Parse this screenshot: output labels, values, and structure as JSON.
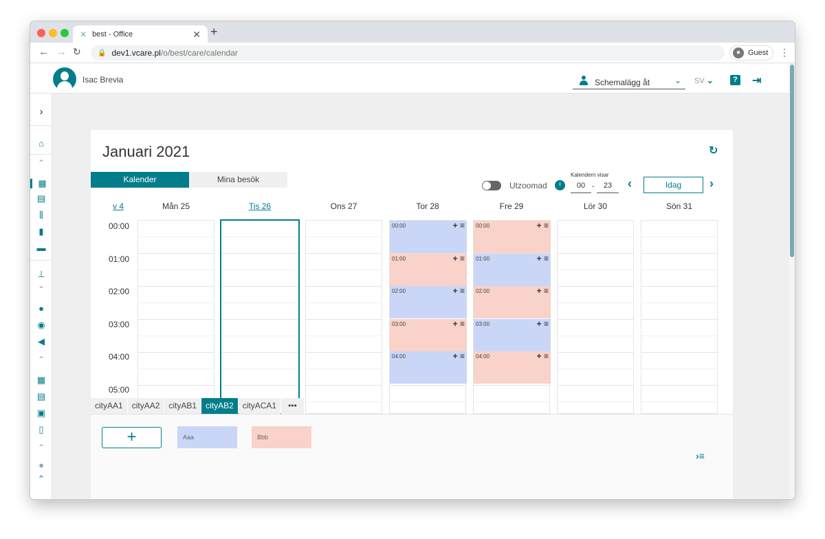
{
  "browser": {
    "tab_title": "best - Office",
    "tab_close": "✕",
    "new_tab": "+",
    "url_domain": "dev1.vcare.pl",
    "url_path": "/o/best/care/calendar",
    "profile_label": "Guest"
  },
  "header": {
    "user_name": "Isac Brevia",
    "schedule_label": "Schemalägg åt",
    "language": "SV",
    "help_label": "?"
  },
  "calendar": {
    "month_title": "Januari 2021",
    "view_tabs": [
      "Kalender",
      "Mina besök"
    ],
    "zoom_label": "Utzoomad",
    "hours_caption": "Kalendern visar",
    "hour_from": "00",
    "hour_to": "23",
    "hour_sep": "-",
    "today_button": "Idag",
    "week_label": "v 4",
    "days": [
      "Mån 25",
      "Tis 26",
      "Ons 27",
      "Tor 28",
      "Fre 29",
      "Lör 30",
      "Sön 31"
    ],
    "today_index": 1,
    "times": [
      "00:00",
      "01:00",
      "02:00",
      "03:00",
      "04:00",
      "05:00"
    ],
    "slots": {
      "thursday": [
        {
          "time": "00:00",
          "color": "#c9d6f7"
        },
        {
          "time": "01:00",
          "color": "#f9d2ca"
        },
        {
          "time": "02:00",
          "color": "#c9d6f7"
        },
        {
          "time": "03:00",
          "color": "#f9d2ca"
        },
        {
          "time": "04:00",
          "color": "#c9d6f7"
        }
      ],
      "friday": [
        {
          "time": "00:00",
          "color": "#f9d2ca"
        },
        {
          "time": "01:00",
          "color": "#c9d6f7"
        },
        {
          "time": "02:00",
          "color": "#f9d2ca"
        },
        {
          "time": "03:00",
          "color": "#c9d6f7"
        },
        {
          "time": "04:00",
          "color": "#f9d2ca"
        }
      ],
      "slot_actions": "+ ≡"
    },
    "city_tabs": [
      "cityAA1",
      "cityAA2",
      "cityAB1",
      "cityAB2",
      "cityACA1",
      "•••"
    ],
    "active_city": "cityAB2"
  },
  "bottom": {
    "add_label": "+",
    "chips": [
      {
        "label": "Aaa",
        "color": "#c9d6f7"
      },
      {
        "label": "Bbb",
        "color": "#f9d2ca"
      }
    ],
    "corner_icon": "›≡"
  },
  "colors": {
    "accent": "#047d8b"
  }
}
